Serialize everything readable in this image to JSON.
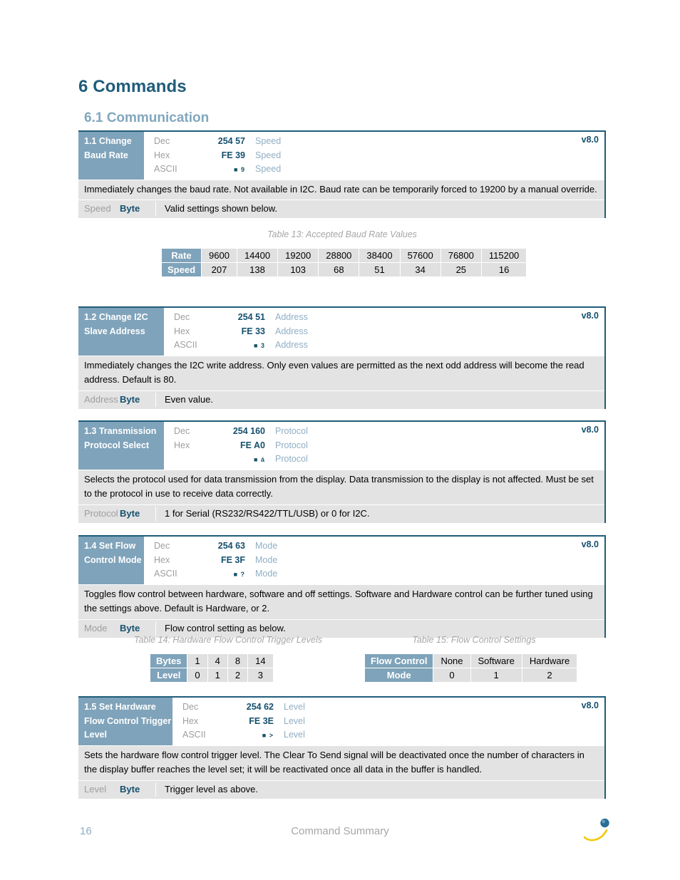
{
  "document": {
    "chapter_title": "6 Commands",
    "section_title": "6.1 Communication",
    "footer": {
      "page_number": "16",
      "title": "Command Summary"
    },
    "colors": {
      "heading": "#1F5C7A",
      "subheading": "#82A7BE",
      "name_cell_bg": "#7FA3BA",
      "row_bg": "#E3E3E3",
      "code_text": "#15506E",
      "param_text": "#8FAEC4",
      "label_text": "#9E9E9E"
    }
  },
  "commands": [
    {
      "name": "1.1 Change Baud Rate",
      "version": "v8.0",
      "rows": [
        {
          "label": "Dec",
          "code": "254 57",
          "param": "Speed"
        },
        {
          "label": "Hex",
          "code": "FE 39",
          "param": "Speed"
        },
        {
          "label": "ASCII",
          "code": "■ 9",
          "param": "Speed"
        }
      ],
      "description": "Immediately changes the baud rate.  Not available in I2C.  Baud rate can be temporarily forced to 19200 by a manual override.",
      "parameters": [
        {
          "name": "Speed",
          "type": "Byte",
          "desc": "Valid settings shown below."
        }
      ]
    },
    {
      "name": "1.2 Change I2C Slave Address",
      "version": "v8.0",
      "rows": [
        {
          "label": "Dec",
          "code": "254 51",
          "param": "Address"
        },
        {
          "label": "Hex",
          "code": "FE 33",
          "param": "Address"
        },
        {
          "label": "ASCII",
          "code": "■ 3",
          "param": "Address"
        }
      ],
      "description": "Immediately changes the I2C write address.  Only even values are permitted as the next odd address will become the read address.  Default is 80.",
      "parameters": [
        {
          "name": "Address",
          "type": "Byte",
          "desc": "Even value."
        }
      ]
    },
    {
      "name": "1.3 Transmission Protocol Select",
      "version": "v8.0",
      "rows": [
        {
          "label": "Dec",
          "code": "254 160",
          "param": "Protocol"
        },
        {
          "label": "Hex",
          "code": "FE A0",
          "param": "Protocol"
        },
        {
          "label": "",
          "code": "■ á",
          "param": "Protocol"
        }
      ],
      "description": "Selects the protocol used for data transmission from the display.  Data transmission to the display is not affected.  Must be set to the protocol in use to receive data correctly.",
      "parameters": [
        {
          "name": "Protocol",
          "type": "Byte",
          "desc": "1 for Serial (RS232/RS422/TTL/USB) or 0 for I2C."
        }
      ]
    },
    {
      "name": "1.4 Set Flow Control Mode",
      "version": "v8.0",
      "rows": [
        {
          "label": "Dec",
          "code": "254 63",
          "param": "Mode"
        },
        {
          "label": "Hex",
          "code": "FE 3F",
          "param": "Mode"
        },
        {
          "label": "ASCII",
          "code": "■ ?",
          "param": "Mode"
        }
      ],
      "description": "Toggles flow control between hardware, software and off settings.  Software and Hardware control can be further tuned using the settings above.  Default is Hardware, or 2.",
      "parameters": [
        {
          "name": "Mode",
          "type": "Byte",
          "desc": "Flow control setting as below."
        }
      ]
    },
    {
      "name": "1.5 Set Hardware Flow Control Trigger Level",
      "version": "v8.0",
      "rows": [
        {
          "label": "Dec",
          "code": "254 62",
          "param": "Level"
        },
        {
          "label": "Hex",
          "code": "FE 3E",
          "param": "Level"
        },
        {
          "label": "ASCII",
          "code": "■ >",
          "param": "Level"
        }
      ],
      "description": "Sets the hardware flow control trigger level.  The Clear To Send signal will be deactivated once the number of characters in the display buffer reaches the level set; it will be reactivated once all data in the buffer is handled.",
      "parameters": [
        {
          "name": "Level",
          "type": "Byte",
          "desc": "Trigger level as above."
        }
      ]
    }
  ],
  "tables": [
    {
      "caption": "Table 13: Accepted Baud Rate Values",
      "rows": [
        {
          "header": "Rate",
          "cells": [
            "9600",
            "14400",
            "19200",
            "28800",
            "38400",
            "57600",
            "76800",
            "115200"
          ]
        },
        {
          "header": "Speed",
          "cells": [
            "207",
            "138",
            "103",
            "68",
            "51",
            "34",
            "25",
            "16"
          ]
        }
      ]
    },
    {
      "caption": "Table 14: Hardware Flow Control Trigger Levels",
      "rows": [
        {
          "header": "Bytes",
          "cells": [
            "1",
            "4",
            "8",
            "14"
          ]
        },
        {
          "header": "Level",
          "cells": [
            "0",
            "1",
            "2",
            "3"
          ]
        }
      ]
    },
    {
      "caption": "Table 15: Flow Control Settings",
      "rows": [
        {
          "header": "Flow Control",
          "cells": [
            "None",
            "Software",
            "Hardware"
          ]
        },
        {
          "header": "Mode",
          "cells": [
            "0",
            "1",
            "2"
          ]
        }
      ]
    }
  ]
}
